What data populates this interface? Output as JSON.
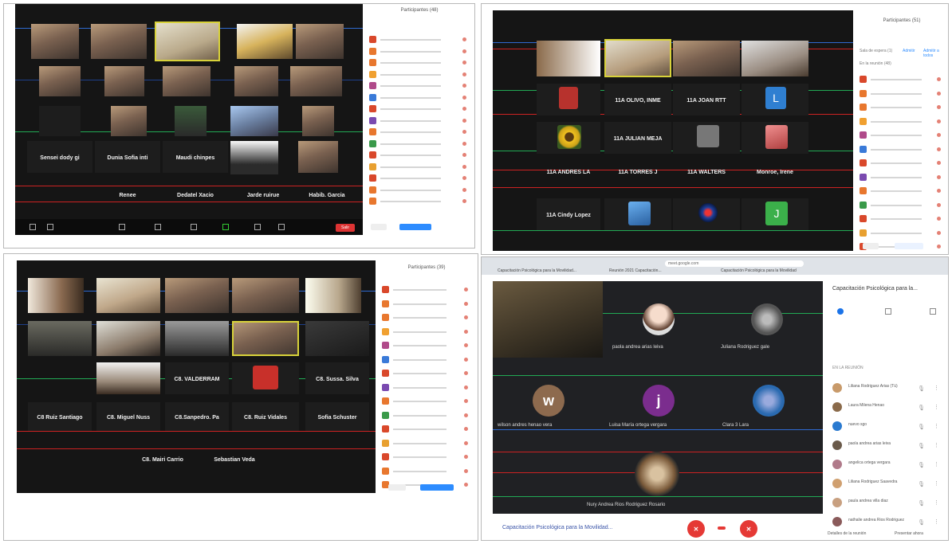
{
  "q1": {
    "participants_title": "Participantes (48)",
    "rows": [
      [
        {
          "name": "",
          "hl": false
        },
        {
          "name": "",
          "hl": false
        },
        {
          "name": "",
          "hl": true
        },
        {
          "name": "",
          "hl": false
        },
        {
          "name": "",
          "hl": false
        }
      ],
      [
        {
          "name": "",
          "hl": false
        },
        {
          "name": "",
          "hl": false
        },
        {
          "name": "",
          "hl": false
        },
        {
          "name": "",
          "hl": false
        },
        {
          "name": "",
          "hl": false
        }
      ],
      [
        {
          "name": "",
          "hl": false
        },
        {
          "name": "",
          "hl": false
        },
        {
          "name": "",
          "hl": false
        },
        {
          "name": "",
          "hl": false
        },
        {
          "name": "",
          "hl": false
        }
      ]
    ],
    "text_tiles_row4": [
      "Sensei dody gi",
      "Dunia Sofia inti",
      "Maudi chinpes",
      ""
    ],
    "text_tiles_row5": [
      "Renee",
      "Dedatel Xacio",
      "Jarde ruirue",
      "Habib. Garcia"
    ],
    "leave_label": "Salir"
  },
  "q2": {
    "participants_title": "Participantes (51)",
    "subtitle": "En la reunión (48)",
    "sort_label": "Sala de espera (1)",
    "btn_admit": "Admitir",
    "btn_admit_all": "Admitir a todos",
    "text_tiles_row2": [
      "11A OLIVO, INME",
      "11A JOAN RTT"
    ],
    "text_tiles_row3": [
      "11A JULIAN MEJA"
    ],
    "text_tiles_row4": [
      "11A ANDRES LA",
      "11A TORRES J",
      "11A WALTERS",
      "Monroe, Irene"
    ],
    "text_tiles_row5": [
      "11A Cindy Lopez"
    ],
    "avatar_letters": [
      "L",
      "J"
    ]
  },
  "q3": {
    "participants_title": "Participantes (39)",
    "text_tiles_row3": [
      "C8. VALDERRAM",
      "C8. Sussa. Silva"
    ],
    "text_tiles_row4": [
      "C8 Ruiz Santiago",
      "C8. Miguel Nuss",
      "C8.Sanpedro. Pa",
      "C8. Ruiz Vidales",
      "Sofia Schuster"
    ],
    "text_tiles_row5": [
      "C8. Mairi Carrio",
      "Sebastian Veda"
    ]
  },
  "q4": {
    "tabs": [
      "Capacitación Psicológica para la Movilidad...",
      "Reunión 2021 Capacitación...",
      "Capacitación Psicológica para la Movilidad"
    ],
    "url": "meet.google.com",
    "side_title": "Capacitación Psicológica para la...",
    "side_section": "EN LA REUNIÓN",
    "bottom_title": "Capacitación Psicológica para la Movilidad...",
    "tile_names": [
      "",
      "paola andrea arias leiva",
      "Juliana Rodriguez gale",
      "wilson andres henao vera",
      "Luisa María ortega vergara",
      "Clara 3 Lara",
      "Nury Andrea Rios Rodriguez Rosario"
    ],
    "avatar_letters": [
      "w",
      "j"
    ],
    "side_people": [
      "Liliana Rodriguez Arias (Tú)",
      "Laura Milena Henao",
      "nuevo sgo",
      "paola andrea arias leiva",
      "angelica ortega vergara",
      "Liliana Rodriguez Saavedra",
      "paula andrea villa diaz",
      "nathalie andrea Rios Rodriguez"
    ],
    "footer_left": "Detalles de la reunión",
    "footer_right": "Presentar ahora",
    "colors": {
      "end_call": "#e53935",
      "meet_bg": "#202124"
    }
  }
}
